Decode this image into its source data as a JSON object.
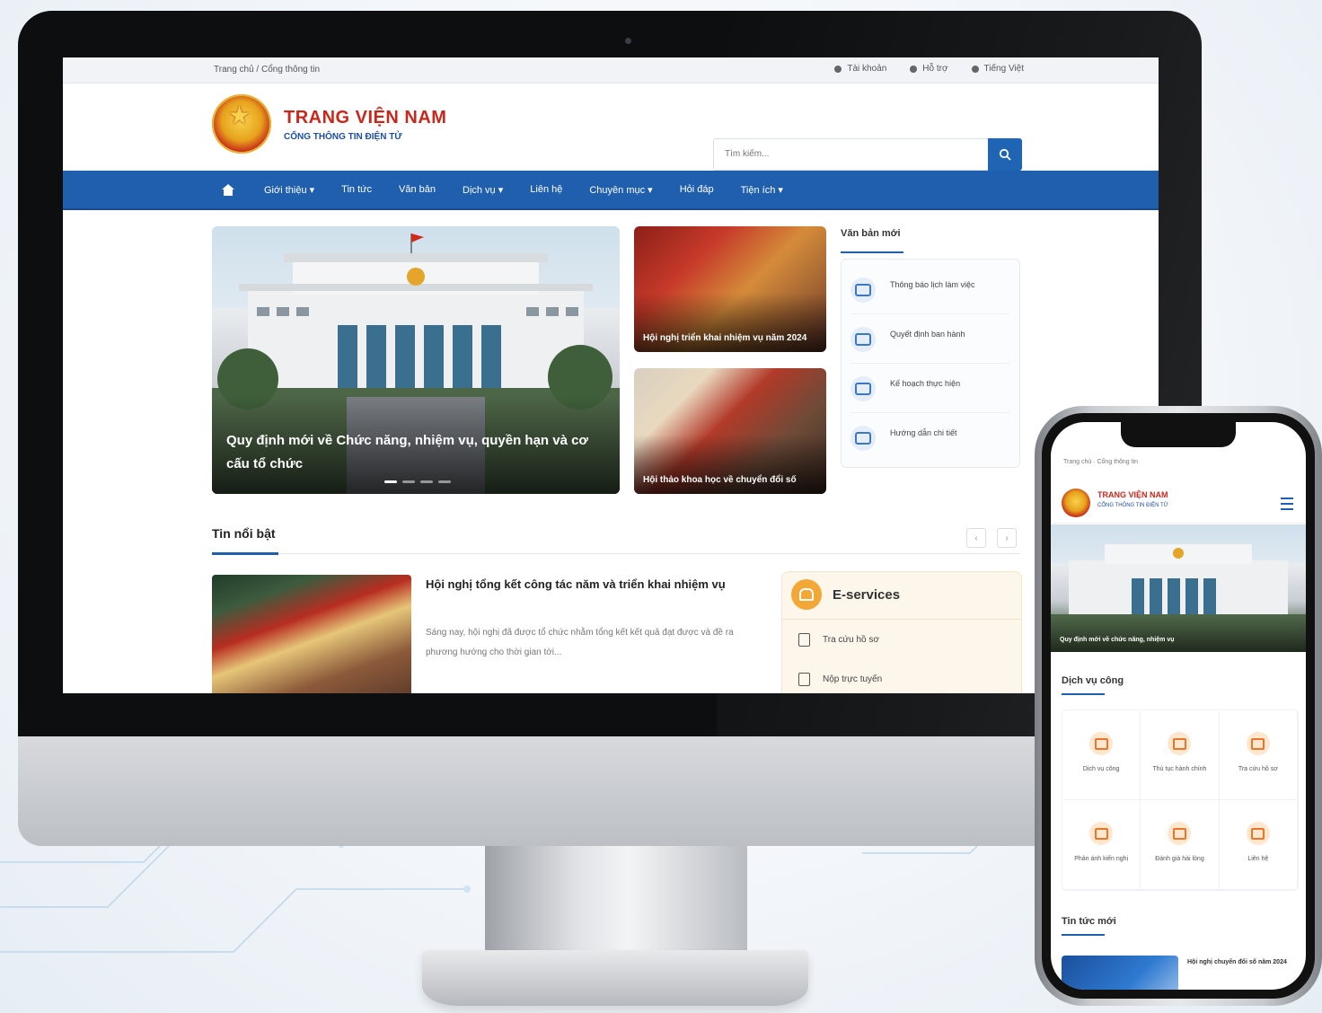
{
  "colors": {
    "nav_blue": "#1f5fae",
    "brand_red": "#c8281c",
    "eservice_orange": "#f3a737"
  },
  "desktop": {
    "topbar": {
      "breadcrumb": "Trang chủ / Cổng thông tin",
      "links": [
        {
          "icon": "user-icon",
          "label": "Tài khoản"
        },
        {
          "icon": "phone-icon",
          "label": "Hỗ trợ"
        },
        {
          "icon": "globe-icon",
          "label": "Tiếng Việt"
        }
      ]
    },
    "header": {
      "brand_title": "TRANG VIỆN NAM",
      "brand_subtitle": "CỔNG THÔNG TIN ĐIỆN TỬ",
      "search_placeholder": "Tìm kiếm...",
      "search_icon": "search-icon"
    },
    "nav": {
      "home_icon": "home-icon",
      "items": [
        {
          "label": "Giới thiệu ▾"
        },
        {
          "label": "Tin tức"
        },
        {
          "label": "Văn bản"
        },
        {
          "label": "Dịch vụ ▾"
        },
        {
          "label": "Liên hệ"
        },
        {
          "label": "Chuyên mục ▾"
        },
        {
          "label": "Hỏi đáp"
        },
        {
          "label": "Tiện ích ▾"
        }
      ]
    },
    "hero": {
      "caption": "Quy định mới về Chức năng, nhiệm vụ, quyền hạn và cơ cấu tổ chức"
    },
    "cards": [
      {
        "caption": "Hội nghị triển khai nhiệm vụ năm 2024"
      },
      {
        "caption": "Hội thảo khoa học về chuyển đổi số"
      }
    ],
    "side_panel": {
      "title": "Văn bản mới",
      "items": [
        {
          "icon": "document-icon",
          "label": "Thông báo lịch làm việc"
        },
        {
          "icon": "document-icon",
          "label": "Quyết định ban hành"
        },
        {
          "icon": "document-icon",
          "label": "Kế hoạch thực hiện"
        },
        {
          "icon": "document-icon",
          "label": "Hướng dẫn chi tiết"
        }
      ]
    },
    "section": {
      "title": "Tin nổi bật",
      "prev": "‹",
      "next": "›"
    },
    "news": {
      "title": "Hội nghị tổng kết công tác năm và triển khai nhiệm vụ",
      "excerpt": "Sáng nay, hội nghị đã được tổ chức nhằm tổng kết kết quả đạt được và đề ra phương hướng cho thời gian tới..."
    },
    "eservices": {
      "title": "E-services",
      "items": [
        {
          "icon": "file-icon",
          "label": "Tra cứu hồ sơ"
        },
        {
          "icon": "calendar-icon",
          "label": "Nộp trực tuyến"
        }
      ]
    }
  },
  "phone": {
    "topbar": "Trang chủ · Cổng thông tin",
    "brand_title": "TRANG VIỆN NAM",
    "brand_subtitle": "CỔNG THÔNG TIN ĐIỆN TỬ",
    "hero_caption": "Quy định mới về chức năng, nhiệm vụ",
    "services_title": "Dịch vụ công",
    "services": [
      {
        "icon": "service-icon",
        "label": "Dịch vụ công"
      },
      {
        "icon": "service-icon",
        "label": "Thủ tục hành chính"
      },
      {
        "icon": "service-icon",
        "label": "Tra cứu hồ sơ"
      },
      {
        "icon": "service-icon",
        "label": "Phản ánh kiến nghị"
      },
      {
        "icon": "service-icon",
        "label": "Đánh giá hài lòng"
      },
      {
        "icon": "service-icon",
        "label": "Liên hệ"
      }
    ],
    "news_title": "Tin tức mới",
    "news_item": "Hội nghị chuyển đổi số năm 2024"
  }
}
